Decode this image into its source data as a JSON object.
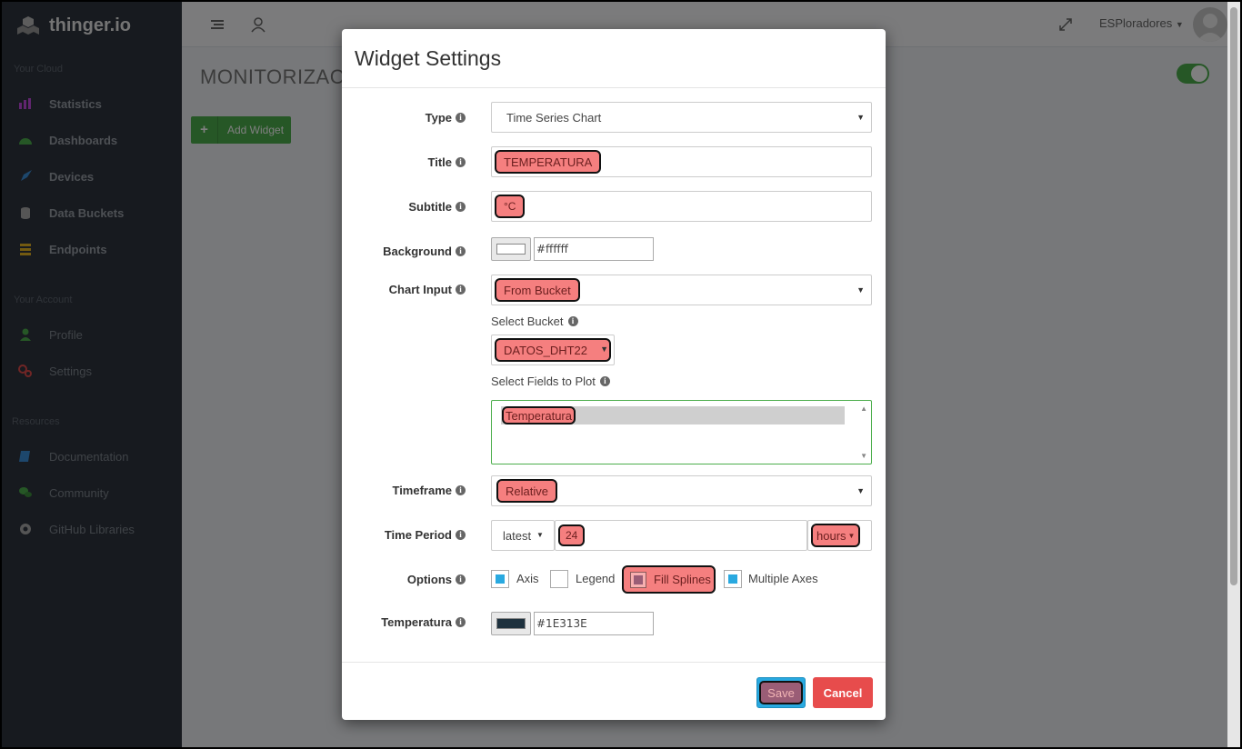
{
  "sidebar": {
    "brand": "thinger.io",
    "sections": [
      "Your Cloud",
      "Your Account",
      "Resources"
    ],
    "cloud_items": [
      {
        "label": "Statistics",
        "icon": "bar-chart-icon",
        "color": "#c24be0"
      },
      {
        "label": "Dashboards",
        "icon": "dashboard-icon",
        "color": "#4cae4c"
      },
      {
        "label": "Devices",
        "icon": "rocket-icon",
        "color": "#3a8fd9"
      },
      {
        "label": "Data Buckets",
        "icon": "database-icon",
        "color": "#aaaaaa"
      },
      {
        "label": "Endpoints",
        "icon": "list-icon",
        "color": "#e6b422"
      }
    ],
    "account_items": [
      {
        "label": "Profile",
        "icon": "user-icon",
        "color": "#4cae4c"
      },
      {
        "label": "Settings",
        "icon": "gears-icon",
        "color": "#e04b4b"
      }
    ],
    "resource_items": [
      {
        "label": "Documentation",
        "icon": "book-icon",
        "color": "#3a8fd9"
      },
      {
        "label": "Community",
        "icon": "comments-icon",
        "color": "#4cae4c"
      },
      {
        "label": "GitHub Libraries",
        "icon": "github-icon",
        "color": "#aaaaaa"
      }
    ]
  },
  "topbar": {
    "user": "ESPloradores"
  },
  "main": {
    "title": "MONITORIZACIO",
    "add_widget": "Add Widget"
  },
  "modal": {
    "title": "Widget Settings",
    "fields": {
      "type": {
        "label": "Type",
        "value": "Time Series Chart"
      },
      "title": {
        "label": "Title",
        "value": "TEMPERATURA"
      },
      "subtitle": {
        "label": "Subtitle",
        "value": "°C"
      },
      "background": {
        "label": "Background",
        "value": "#ffffff",
        "swatch": "#ffffff"
      },
      "chart_input": {
        "label": "Chart Input",
        "value": "From Bucket"
      },
      "select_bucket": {
        "label": "Select Bucket",
        "value": "DATOS_DHT22"
      },
      "select_fields": {
        "label": "Select Fields to Plot",
        "value": "Temperatura"
      },
      "timeframe": {
        "label": "Timeframe",
        "value": "Relative"
      },
      "time_period": {
        "label": "Time Period",
        "mode": "latest",
        "amount": "24",
        "unit": "hours"
      },
      "options": {
        "label": "Options",
        "items": [
          {
            "label": "Axis",
            "checked": true
          },
          {
            "label": "Legend",
            "checked": false
          },
          {
            "label": "Fill Splines",
            "checked": true
          },
          {
            "label": "Multiple Axes",
            "checked": true
          }
        ]
      },
      "temperatura_color": {
        "label": "Temperatura",
        "value": "#1E313E",
        "swatch": "#1E313E"
      }
    },
    "save": "Save",
    "cancel": "Cancel"
  }
}
